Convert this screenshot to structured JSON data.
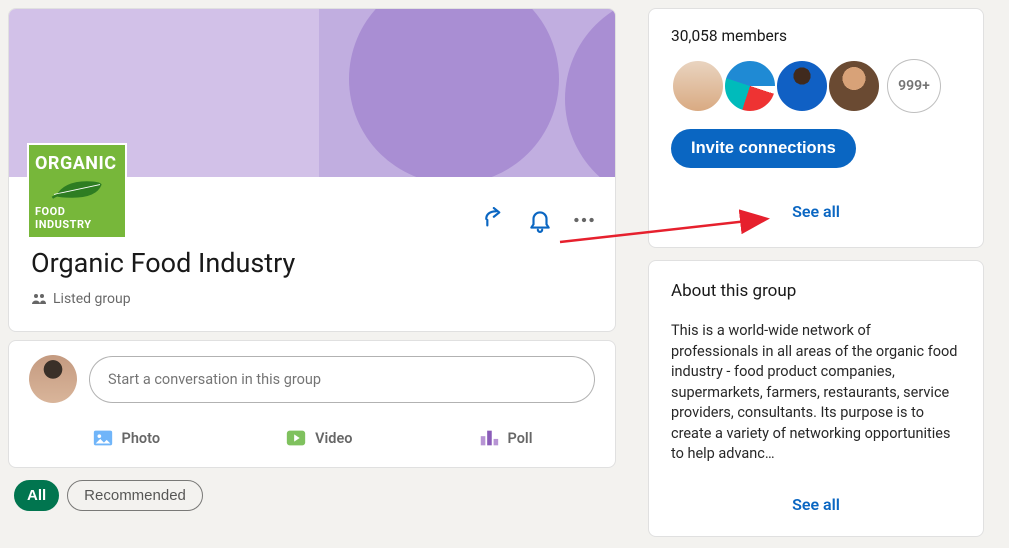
{
  "header": {
    "logo_top": "ORGANIC",
    "logo_bottom": "FOOD INDUSTRY",
    "title": "Organic Food Industry",
    "listed_label": "Listed group"
  },
  "postbox": {
    "placeholder": "Start a conversation in this group",
    "photo": "Photo",
    "video": "Video",
    "poll": "Poll"
  },
  "chips": {
    "all": "All",
    "recommended": "Recommended"
  },
  "members": {
    "count_label": "30,058 members",
    "overflow": "999+",
    "invite": "Invite connections",
    "see_all": "See all"
  },
  "about": {
    "title": "About this group",
    "text": "This is a world-wide network of professionals in all areas of the organic food industry - food product companies, supermarkets, farmers, restaurants, service providers, consultants. Its purpose is to create a variety of networking opportunities to help advanc…",
    "see_all": "See all"
  }
}
